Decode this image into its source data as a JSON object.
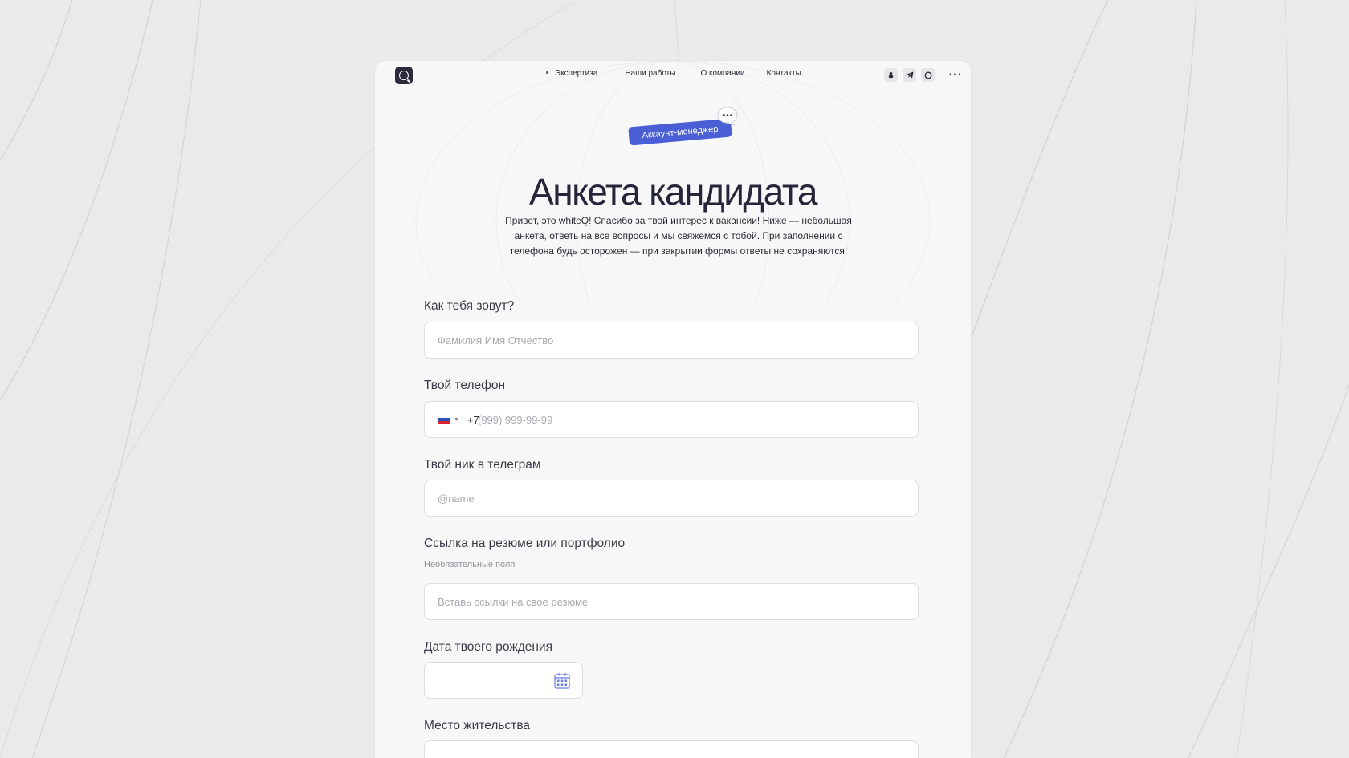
{
  "nav": {
    "links": [
      "Экспертиза",
      "Наши работы",
      "О компании",
      "Контакты"
    ],
    "icons": [
      "vk-icon",
      "telegram-icon",
      "whatsapp-icon"
    ],
    "more_label": "···"
  },
  "hero": {
    "badge": "Аккаунт-менеджер",
    "title": "Анкета кандидата",
    "intro": "Привет, это whiteQ! Спасибо за твой интерес к вакансии! Ниже — небольшая анкета, ответь на все вопросы и мы свяжемся с тобой. При заполнении с телефона будь осторожен — при закрытии формы ответы не сохраняются!"
  },
  "form": {
    "name": {
      "label": "Как тебя зовут?",
      "placeholder": "Фамилия Имя Отчество"
    },
    "phone": {
      "label": "Твой телефон",
      "code": "+7",
      "placeholder": "(999) 999-99-99"
    },
    "telegram": {
      "label": "Твой ник в телеграм",
      "placeholder": "@name"
    },
    "resume": {
      "label": "Ссылка на резюме или портфолио",
      "hint": "Необязательные поля",
      "placeholder": "Вставь ссылки на свое резюме"
    },
    "birthdate": {
      "label": "Дата твоего рождения"
    },
    "residence": {
      "label": "Место жительства"
    }
  },
  "colors": {
    "accent": "#4a5ed6",
    "title": "#26263a",
    "background": "#eaeaea",
    "card": "#f7f7f7"
  }
}
